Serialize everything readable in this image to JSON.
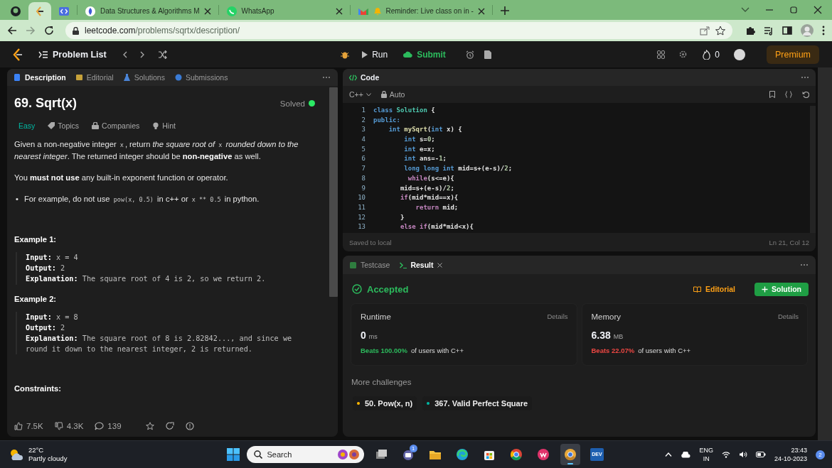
{
  "browser": {
    "tabs": [
      {
        "selected": false
      },
      {
        "selected": true
      },
      {
        "selected": false
      },
      {
        "title": "Data Structures & Algorithms M",
        "selected": false
      },
      {
        "title": "WhatsApp",
        "selected": false
      },
      {
        "title": "Reminder: Live class on in -",
        "selected": false
      }
    ],
    "url": {
      "host": "leetcode.com",
      "path": "/problems/sqrtx/description/"
    }
  },
  "nav": {
    "problem_list": "Problem List",
    "run": "Run",
    "submit": "Submit",
    "streak": "0",
    "premium": "Premium"
  },
  "description": {
    "tabs": [
      {
        "label": "Description",
        "selected": true
      },
      {
        "label": "Editorial",
        "selected": false
      },
      {
        "label": "Solutions",
        "selected": false
      },
      {
        "label": "Submissions",
        "selected": false
      }
    ],
    "title": "69. Sqrt(x)",
    "status": "Solved",
    "difficulty": "Easy",
    "tags": [
      "Topics",
      "Companies",
      "Hint"
    ],
    "paragraphs": [
      [
        {
          "kind": "plain",
          "text": "Given a non-negative integer "
        },
        {
          "kind": "code",
          "text": "x"
        },
        {
          "kind": "plain",
          "text": ", return "
        },
        {
          "kind": "italic",
          "text": "the square root of "
        },
        {
          "kind": "code",
          "text": "x"
        },
        {
          "kind": "italic",
          "text": " rounded down to the nearest integer"
        },
        {
          "kind": "plain",
          "text": ". The returned integer should be "
        },
        {
          "kind": "bold",
          "text": "non-negative"
        },
        {
          "kind": "plain",
          "text": " as well."
        }
      ],
      [
        {
          "kind": "plain",
          "text": "You "
        },
        {
          "kind": "bold",
          "text": "must not use"
        },
        {
          "kind": "plain",
          "text": " any built-in exponent function or operator."
        }
      ]
    ],
    "bullets": [
      {
        "marker": "•",
        "segments": [
          {
            "kind": "plain",
            "text": "For example, do not use "
          },
          {
            "kind": "code",
            "text": "pow(x, 0.5)"
          },
          {
            "kind": "plain",
            "text": " in c++ or "
          },
          {
            "kind": "code",
            "text": "x ** 0.5"
          },
          {
            "kind": "plain",
            "text": " in python."
          }
        ]
      }
    ],
    "examples": [
      {
        "title": "Example 1:",
        "lines": [
          {
            "label": "Input:",
            "value": "x = 4"
          },
          {
            "label": "Output:",
            "value": "2"
          },
          {
            "label": "Explanation:",
            "value": "The square root of 4 is 2, so we return 2."
          }
        ]
      },
      {
        "title": "Example 2:",
        "lines": [
          {
            "label": "Input:",
            "value": "x = 8"
          },
          {
            "label": "Output:",
            "value": "2"
          },
          {
            "label": "Explanation:",
            "value": "The square root of 8 is 2.82842..., and since we round it down to the nearest integer, 2 is returned."
          }
        ]
      }
    ],
    "constraints_title": "Constraints:",
    "footer": {
      "likes": "7.5K",
      "dislikes": "4.3K",
      "comments": "139"
    }
  },
  "code": {
    "title": "Code",
    "language": "C++",
    "mode": "Auto",
    "status": "Saved to local",
    "cursor": "Ln 21, Col 12",
    "lines": [
      {
        "number": "1",
        "tokens": [
          {
            "kind": "keyword",
            "text": "class "
          },
          {
            "kind": "type",
            "text": "Solution"
          },
          {
            "kind": "plain",
            "text": " {"
          }
        ]
      },
      {
        "number": "2",
        "tokens": [
          {
            "kind": "keyword",
            "text": "public:"
          }
        ]
      },
      {
        "number": "3",
        "tokens": [
          {
            "kind": "keyword",
            "text": "    int "
          },
          {
            "kind": "function",
            "text": "mySqrt"
          },
          {
            "kind": "plain",
            "text": "("
          },
          {
            "kind": "keyword",
            "text": "int"
          },
          {
            "kind": "plain",
            "text": " x) {"
          }
        ]
      },
      {
        "number": "4",
        "tokens": [
          {
            "kind": "keyword",
            "text": "        int"
          },
          {
            "kind": "plain",
            "text": " s="
          },
          {
            "kind": "number",
            "text": "0"
          },
          {
            "kind": "plain",
            "text": ";"
          }
        ]
      },
      {
        "number": "5",
        "tokens": [
          {
            "kind": "keyword",
            "text": "        int"
          },
          {
            "kind": "plain",
            "text": " e=x;"
          }
        ]
      },
      {
        "number": "6",
        "tokens": [
          {
            "kind": "keyword",
            "text": "        int"
          },
          {
            "kind": "plain",
            "text": " ans=-"
          },
          {
            "kind": "number",
            "text": "1"
          },
          {
            "kind": "plain",
            "text": ";"
          }
        ]
      },
      {
        "number": "7",
        "tokens": [
          {
            "kind": "keyword",
            "text": "        long long int"
          },
          {
            "kind": "plain",
            "text": " mid=s+(e-s)/"
          },
          {
            "kind": "number",
            "text": "2"
          },
          {
            "kind": "plain",
            "text": ";"
          }
        ]
      },
      {
        "number": "8",
        "tokens": [
          {
            "kind": "control",
            "text": "         while"
          },
          {
            "kind": "plain",
            "text": "(s<=e){"
          }
        ]
      },
      {
        "number": "9",
        "tokens": [
          {
            "kind": "plain",
            "text": "       mid=s+(e-s)/"
          },
          {
            "kind": "number",
            "text": "2"
          },
          {
            "kind": "plain",
            "text": ";"
          }
        ]
      },
      {
        "number": "10",
        "tokens": [
          {
            "kind": "control",
            "text": "       if"
          },
          {
            "kind": "plain",
            "text": "(mid*mid==x){"
          }
        ]
      },
      {
        "number": "11",
        "tokens": [
          {
            "kind": "control",
            "text": "           return"
          },
          {
            "kind": "plain",
            "text": " mid;"
          }
        ]
      },
      {
        "number": "12",
        "tokens": [
          {
            "kind": "plain",
            "text": "       }"
          }
        ]
      },
      {
        "number": "13",
        "tokens": [
          {
            "kind": "control",
            "text": "       else if"
          },
          {
            "kind": "plain",
            "text": "(mid*mid<x){"
          }
        ]
      }
    ]
  },
  "result": {
    "tabs": [
      {
        "label": "Testcase",
        "selected": false
      },
      {
        "label": "Result",
        "selected": true
      }
    ],
    "verdict": "Accepted",
    "editorial": "Editorial",
    "solution": "Solution",
    "metrics": [
      {
        "label": "Runtime",
        "details": "Details",
        "value": "0",
        "unit": "ms",
        "beats": "Beats 100.00%",
        "rest": "of users with C++",
        "color": "#2cbb5d"
      },
      {
        "label": "Memory",
        "details": "Details",
        "value": "6.38",
        "unit": "MB",
        "beats": "Beats 22.07%",
        "rest": "of users with C++",
        "color": "#ef4743"
      }
    ],
    "more_title": "More challenges",
    "challenges": [
      {
        "title": "50. Pow(x, n)",
        "color": "#ffb800"
      },
      {
        "title": "367. Valid Perfect Square",
        "color": "#00b8a3"
      }
    ]
  },
  "taskbar": {
    "temperature": "22°C",
    "weather": "Partly cloudy",
    "search": "Search",
    "apps": [
      {
        "selected": false
      },
      {
        "selected": false,
        "badge": "1"
      },
      {
        "selected": false
      },
      {
        "selected": false
      },
      {
        "selected": false
      },
      {
        "selected": false
      },
      {
        "selected": false
      },
      {
        "selected": true
      },
      {
        "selected": false,
        "label": "DEV"
      }
    ],
    "language": "ENG",
    "region": "IN",
    "time": "23:43",
    "date": "24-10-2023",
    "notifications": "2"
  }
}
